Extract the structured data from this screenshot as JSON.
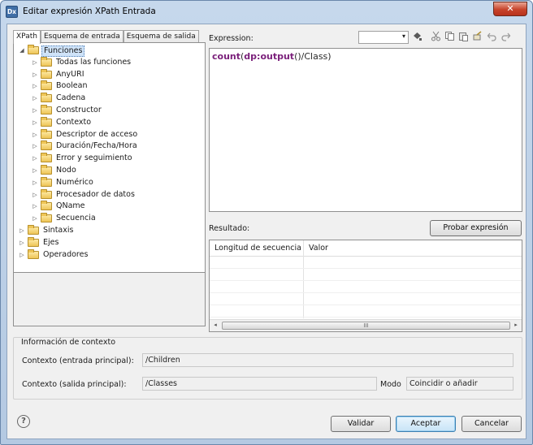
{
  "window": {
    "title": "Editar expresión XPath Entrada",
    "icon_text": "Dx",
    "close_glyph": "✕"
  },
  "tabs": [
    {
      "label": "XPath",
      "active": true
    },
    {
      "label": "Esquema de entrada",
      "active": false
    },
    {
      "label": "Esquema de salida",
      "active": false
    }
  ],
  "tree": {
    "nodes": [
      {
        "label": "Funciones",
        "level": 0,
        "expanded": true,
        "selected": true
      },
      {
        "label": "Todas las funciones",
        "level": 1
      },
      {
        "label": "AnyURI",
        "level": 1
      },
      {
        "label": "Boolean",
        "level": 1
      },
      {
        "label": "Cadena",
        "level": 1
      },
      {
        "label": "Constructor",
        "level": 1
      },
      {
        "label": "Contexto",
        "level": 1
      },
      {
        "label": "Descriptor de acceso",
        "level": 1
      },
      {
        "label": "Duración/Fecha/Hora",
        "level": 1
      },
      {
        "label": "Error y seguimiento",
        "level": 1
      },
      {
        "label": "Nodo",
        "level": 1
      },
      {
        "label": "Numérico",
        "level": 1
      },
      {
        "label": "Procesador de datos",
        "level": 1
      },
      {
        "label": "QName",
        "level": 1
      },
      {
        "label": "Secuencia",
        "level": 1
      },
      {
        "label": "Sintaxis",
        "level": 0
      },
      {
        "label": "Ejes",
        "level": 0
      },
      {
        "label": "Operadores",
        "level": 0
      }
    ]
  },
  "expression": {
    "label": "Expression:",
    "fn": "count",
    "p1": "(",
    "ns": "dp:output",
    "rest": "()/Class)"
  },
  "result": {
    "label": "Resultado:",
    "test_button": "Probar expresión",
    "columns": [
      "Longitud de secuencia",
      "Valor"
    ]
  },
  "context": {
    "group_title": "Información de contexto",
    "input_label": "Contexto (entrada principal):",
    "input_value": "/Children",
    "output_label": "Contexto (salida principal):",
    "output_value": "/Classes",
    "mode_label": "Modo",
    "mode_value": "Coincidir o añadir"
  },
  "buttons": {
    "validate": "Validar",
    "accept": "Aceptar",
    "cancel": "Cancelar"
  },
  "icons": {
    "help": "?",
    "combo_arrow": "▾",
    "scroll_left": "◂",
    "scroll_right": "▸",
    "scroll_grip": "III"
  }
}
